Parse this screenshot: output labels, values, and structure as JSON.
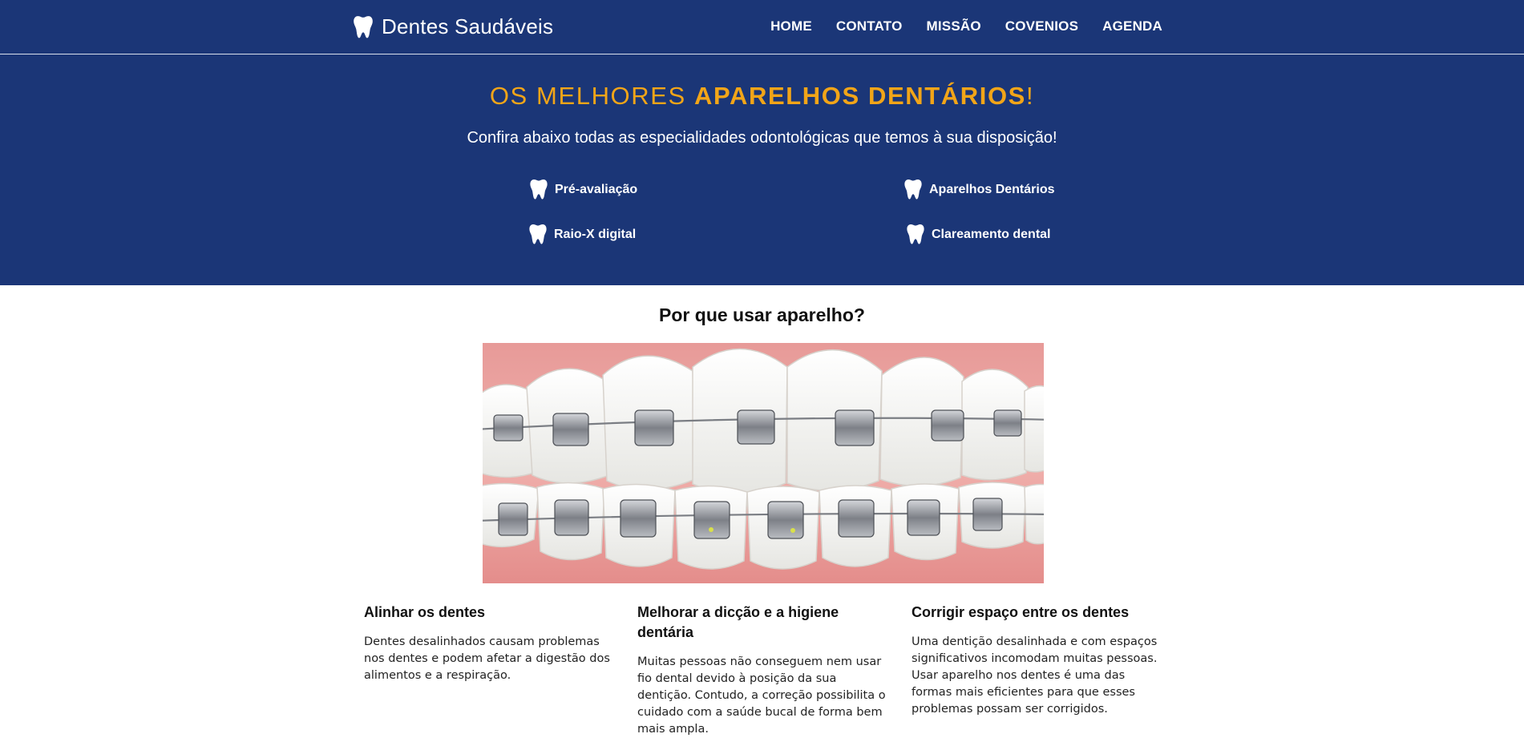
{
  "navbar": {
    "brand_text": "Dentes Saudáveis",
    "brand_icon": "tooth-icon",
    "links": [
      "HOME",
      "CONTATO",
      "MISSÃO",
      "COVENIOS",
      "AGENDA"
    ]
  },
  "hero": {
    "title_light": "OS MELHORES ",
    "title_strong": "APARELHOS DENTÁRIOS",
    "title_end": "!",
    "subtitle": "Confira abaixo todas as especialidades odontológicas que temos à sua disposição!",
    "specialties": [
      {
        "label": "Pré-avaliação",
        "icon": "tooth-icon"
      },
      {
        "label": "Aparelhos Dentários",
        "icon": "tooth-icon"
      },
      {
        "label": "Raio-X digital",
        "icon": "tooth-icon"
      },
      {
        "label": "Clareamento dental",
        "icon": "tooth-icon"
      }
    ]
  },
  "why": {
    "title": "Por que usar aparelho?",
    "benefits": [
      {
        "title": "Alinhar os dentes",
        "text": "Dentes desalinhados causam problemas nos dentes e podem afetar a digestão dos alimentos e a respiração."
      },
      {
        "title": "Melhorar a dicção e a higiene dentária",
        "text": "Muitas pessoas não conseguem nem usar fio dental devido à posição da sua dentição. Contudo, a correção possibilita o cuidado com a saúde bucal de forma bem mais ampla."
      },
      {
        "title": "Corrigir espaço entre os dentes",
        "text": "Uma dentição desalinhada e com espaços significativos incomodam muitas pessoas. Usar aparelho nos dentes é uma das formas mais eficientes para que esses problemas possam ser corrigidos."
      }
    ]
  },
  "colors": {
    "navy": "#1b3677",
    "accent": "#f2a518",
    "white": "#ffffff"
  }
}
